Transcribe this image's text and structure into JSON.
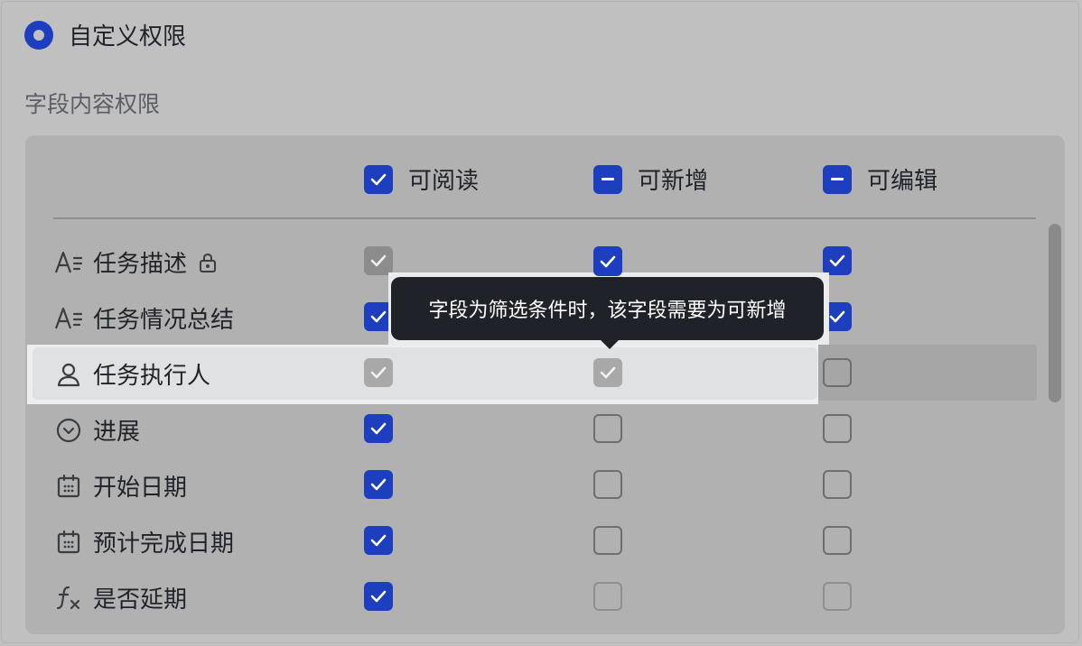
{
  "custom_permission": {
    "label": "自定义权限"
  },
  "section": {
    "label": "字段内容权限"
  },
  "columns": [
    {
      "label": "可阅读",
      "state": "checked"
    },
    {
      "label": "可新增",
      "state": "indeterminate"
    },
    {
      "label": "可编辑",
      "state": "indeterminate"
    }
  ],
  "rows": [
    {
      "label": "任务描述",
      "icon": "text-field-icon",
      "locked": true,
      "read": "disabled-checked",
      "add": "checked",
      "edit": "checked"
    },
    {
      "label": "任务情况总结",
      "icon": "text-field-icon",
      "locked": false,
      "read": "checked",
      "add": "checked",
      "edit": "checked"
    },
    {
      "label": "任务执行人",
      "icon": "person-icon",
      "locked": false,
      "read": "disabled-checked",
      "add": "disabled-checked",
      "edit": "unchecked"
    },
    {
      "label": "进展",
      "icon": "dropdown-circle-icon",
      "locked": false,
      "read": "checked",
      "add": "unchecked",
      "edit": "unchecked"
    },
    {
      "label": "开始日期",
      "icon": "calendar-icon",
      "locked": false,
      "read": "checked",
      "add": "unchecked",
      "edit": "unchecked"
    },
    {
      "label": "预计完成日期",
      "icon": "calendar-icon",
      "locked": false,
      "read": "checked",
      "add": "unchecked",
      "edit": "unchecked"
    },
    {
      "label": "是否延期",
      "icon": "formula-icon",
      "locked": false,
      "read": "checked",
      "add": "unchecked-disabled",
      "edit": "unchecked-disabled"
    }
  ],
  "tooltip": {
    "text": "字段为筛选条件时，该字段需要为可新增"
  },
  "colors": {
    "accent": "#1d3fbf",
    "tooltip_bg": "#1f2329"
  }
}
